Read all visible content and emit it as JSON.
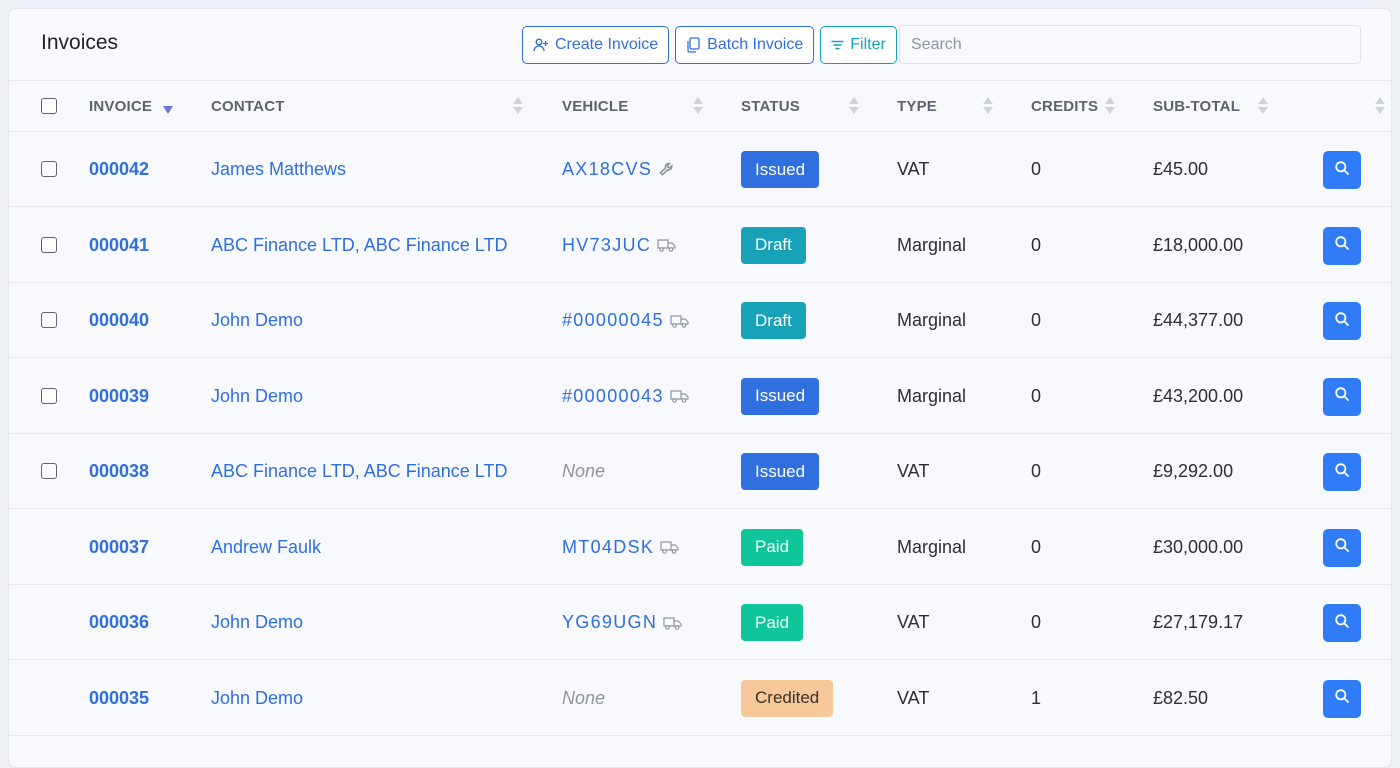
{
  "header": {
    "title": "Invoices",
    "create_label": "Create Invoice",
    "batch_label": "Batch Invoice",
    "filter_label": "Filter",
    "search_placeholder": "Search"
  },
  "columns": {
    "invoice": "INVOICE",
    "contact": "CONTACT",
    "vehicle": "VEHICLE",
    "status": "STATUS",
    "type": "TYPE",
    "credits": "CREDITS",
    "subtotal": "SUB-TOTAL"
  },
  "colors": {
    "issued": "#2f6fe0",
    "draft": "#17a2b8",
    "paid": "#0fc59a",
    "credited": "#f7c89a",
    "link": "#2f6fe0"
  },
  "rows": [
    {
      "invoice": "000042",
      "contact": "James Matthews",
      "vehicle": "AX18CVS",
      "vehicle_icon": "wrench-icon",
      "status": "Issued",
      "type": "VAT",
      "credits": "0",
      "subtotal": "£45.00",
      "checkbox": true
    },
    {
      "invoice": "000041",
      "contact": "ABC Finance LTD, ABC Finance LTD",
      "vehicle": "HV73JUC",
      "vehicle_icon": "truck-icon",
      "status": "Draft",
      "type": "Marginal",
      "credits": "0",
      "subtotal": "£18,000.00",
      "checkbox": true
    },
    {
      "invoice": "000040",
      "contact": "John Demo",
      "vehicle": "#00000045",
      "vehicle_icon": "truck-icon",
      "status": "Draft",
      "type": "Marginal",
      "credits": "0",
      "subtotal": "£44,377.00",
      "checkbox": true
    },
    {
      "invoice": "000039",
      "contact": "John Demo",
      "vehicle": "#00000043",
      "vehicle_icon": "truck-icon",
      "status": "Issued",
      "type": "Marginal",
      "credits": "0",
      "subtotal": "£43,200.00",
      "checkbox": true
    },
    {
      "invoice": "000038",
      "contact": "ABC Finance LTD, ABC Finance LTD",
      "vehicle": "None",
      "vehicle_icon": "",
      "status": "Issued",
      "type": "VAT",
      "credits": "0",
      "subtotal": "£9,292.00",
      "checkbox": true
    },
    {
      "invoice": "000037",
      "contact": "Andrew Faulk",
      "vehicle": "MT04DSK",
      "vehicle_icon": "truck-icon",
      "status": "Paid",
      "type": "Marginal",
      "credits": "0",
      "subtotal": "£30,000.00",
      "checkbox": false
    },
    {
      "invoice": "000036",
      "contact": "John Demo",
      "vehicle": "YG69UGN",
      "vehicle_icon": "truck-icon",
      "status": "Paid",
      "type": "VAT",
      "credits": "0",
      "subtotal": "£27,179.17",
      "checkbox": false
    },
    {
      "invoice": "000035",
      "contact": "John Demo",
      "vehicle": "None",
      "vehicle_icon": "",
      "status": "Credited",
      "type": "VAT",
      "credits": "1",
      "subtotal": "£82.50",
      "checkbox": false
    }
  ]
}
